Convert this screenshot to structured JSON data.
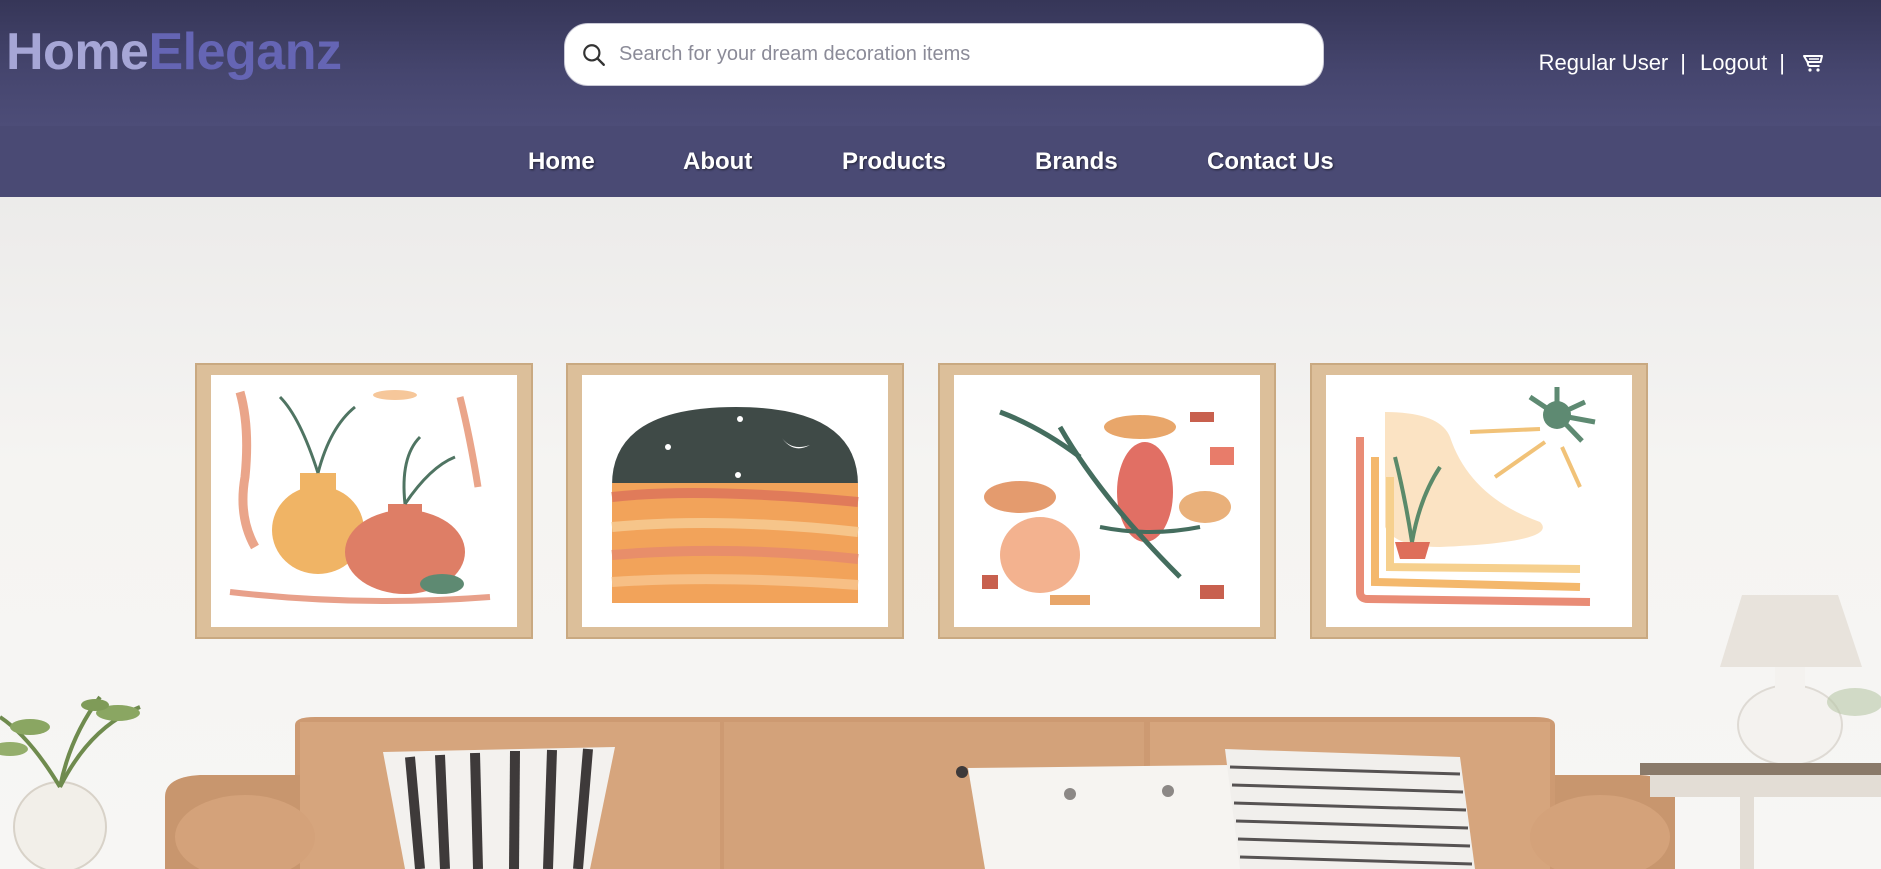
{
  "header": {
    "logo_part1": "Home",
    "logo_part2": "Eleganz",
    "search": {
      "placeholder": "Search for your dream decoration items",
      "value": ""
    },
    "user_label": "Regular User",
    "separator": "|",
    "logout_label": "Logout",
    "cart_icon": "cart-icon",
    "search_icon": "search-icon"
  },
  "nav": {
    "items": [
      {
        "label": "Home"
      },
      {
        "label": "About"
      },
      {
        "label": "Products"
      },
      {
        "label": "Brands"
      },
      {
        "label": "Contact Us"
      }
    ]
  },
  "hero": {
    "image": "living-room-with-four-framed-botanical-art-prints-above-tan-sofa"
  },
  "colors": {
    "header_bg": "#3f3f66",
    "nav_bg": "#4a4a74",
    "logo_light": "#a6a6d6",
    "logo_accent": "#6565b4"
  }
}
